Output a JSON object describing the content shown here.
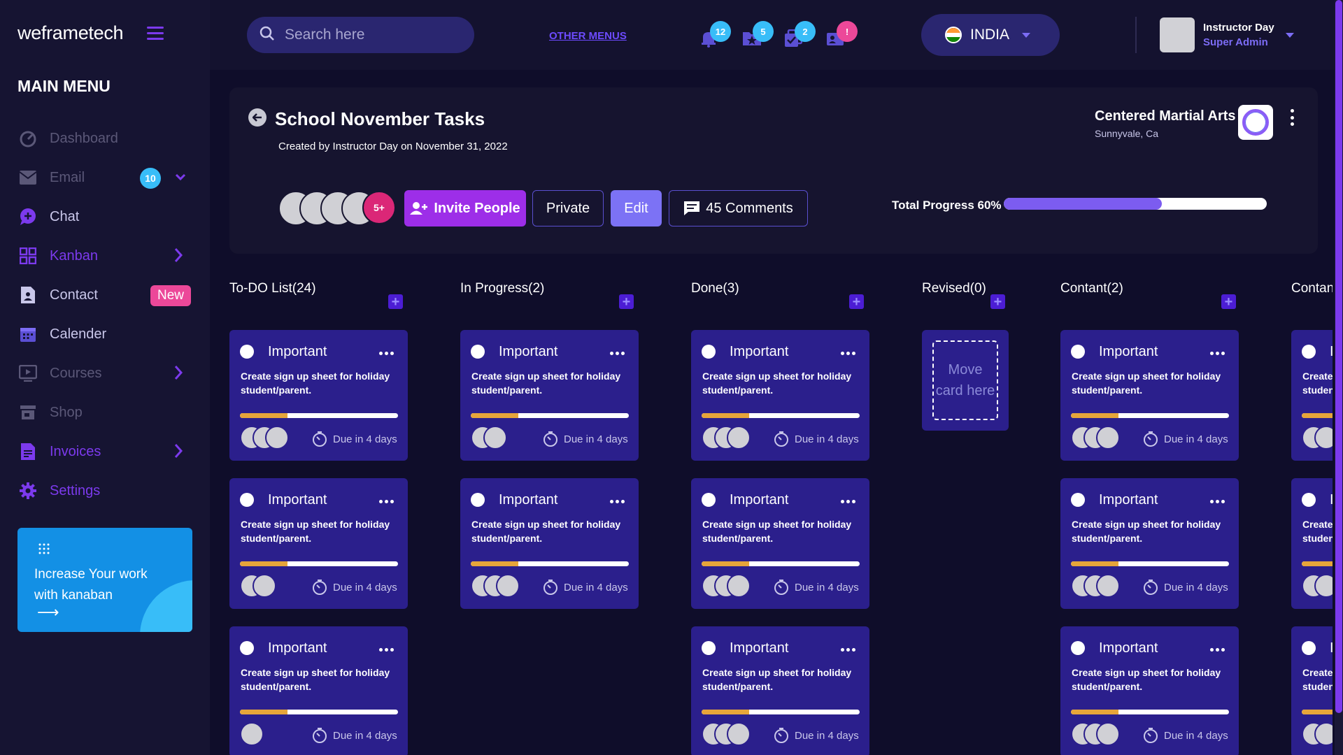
{
  "app": {
    "logo": "weframetech"
  },
  "sidebar": {
    "menu_title": "MAIN MENU",
    "items": [
      {
        "label": "Dashboard"
      },
      {
        "label": "Email",
        "badge": "10"
      },
      {
        "label": "Chat"
      },
      {
        "label": "Kanban"
      },
      {
        "label": "Contact",
        "badge": "New"
      },
      {
        "label": "Calender"
      },
      {
        "label": "Courses"
      },
      {
        "label": "Shop"
      },
      {
        "label": "Invoices"
      },
      {
        "label": "Settings"
      }
    ],
    "promo": {
      "text": "Increase Your work with kanaban",
      "arrow": "⟶"
    }
  },
  "topbar": {
    "search_placeholder": "Search here",
    "other_menus": "OTHER MENUS",
    "notifications": [
      {
        "icon": "bell-icon",
        "count": "12",
        "color": "#38bdf8"
      },
      {
        "icon": "star-folder-icon",
        "count": "5",
        "color": "#38bdf8"
      },
      {
        "icon": "tasks-check-icon",
        "count": "2",
        "color": "#38bdf8"
      },
      {
        "icon": "user-card-icon",
        "count": "!",
        "color": "#ec4899"
      }
    ],
    "country": "INDIA",
    "user_name": "Instructor Day",
    "user_role": "Super Admin"
  },
  "header": {
    "title": "School November Tasks",
    "subtitle": "Created by Instructor Day on November 31, 2022",
    "org_name": "Centered Martial Arts",
    "org_location": "Sunnyvale, Ca",
    "more_members": "5+",
    "invite_label": "Invite People",
    "private_label": "Private",
    "edit_label": "Edit",
    "comments_label": "45 Comments",
    "progress_label": "Total Progress 60%",
    "progress_value": 0.6
  },
  "columns": [
    {
      "title": "To-DO List(24)"
    },
    {
      "title": "In Progress(2)"
    },
    {
      "title": "Done(3)"
    },
    {
      "title": "Revised(0)"
    },
    {
      "title": "Contant(2)"
    },
    {
      "title": "Contant"
    }
  ],
  "card": {
    "tag": "Important",
    "description": "Create sign up sheet for holiday student/parent.",
    "due": "Due in 4 days",
    "progress": 0.3
  },
  "drop_zone": "Move card here",
  "colors": {
    "accent": "#7c3aed",
    "card_bg": "#2b1f8c",
    "progress_fill": "#7c5cf0",
    "card_progress": "#e6a53a",
    "pink": "#ec4899",
    "cyan": "#38bdf8"
  }
}
